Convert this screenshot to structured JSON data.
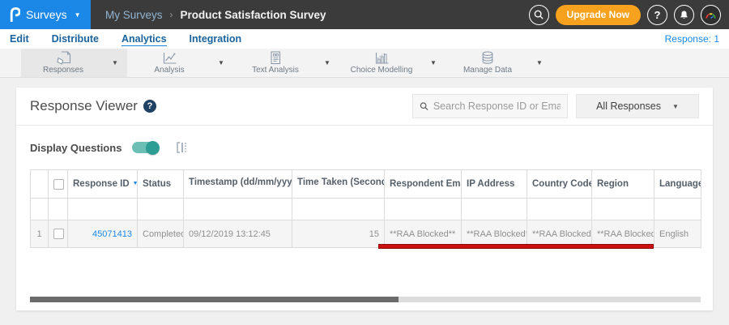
{
  "topbar": {
    "logo_letter": "P",
    "app_menu_label": "Surveys",
    "breadcrumb": {
      "parent": "My Surveys",
      "separator": "›",
      "current": "Product Satisfaction Survey"
    },
    "upgrade_button": "Upgrade Now",
    "help_badge": "?"
  },
  "nav": {
    "items": [
      {
        "label": "Edit",
        "active": false
      },
      {
        "label": "Distribute",
        "active": false
      },
      {
        "label": "Analytics",
        "active": true
      },
      {
        "label": "Integration",
        "active": false
      }
    ],
    "response_count": "Response: 1"
  },
  "toolbar": {
    "items": [
      {
        "label": "Responses",
        "icon": "responses-icon",
        "active": true
      },
      {
        "label": "Analysis",
        "icon": "line-chart-icon",
        "active": false
      },
      {
        "label": "Text Analysis",
        "icon": "text-document-icon",
        "active": false
      },
      {
        "label": "Choice Modelling",
        "icon": "bar-chart-icon",
        "active": false
      },
      {
        "label": "Manage Data",
        "icon": "database-icon",
        "active": false
      }
    ]
  },
  "viewer": {
    "title": "Response Viewer",
    "help_badge": "?",
    "search_placeholder": "Search Response ID or Email",
    "filter_selected": "All Responses",
    "display_questions_label": "Display Questions",
    "display_questions_on": true
  },
  "table": {
    "headers": {
      "response_id": "Response ID",
      "status": "Status",
      "timestamp": "Timestamp (dd/mm/yyyy)",
      "time_taken": "Time Taken (Seconds)",
      "respondent_email": "Respondent Email",
      "ip_address": "IP Address",
      "country_code": "Country Code",
      "region": "Region",
      "language": "Language"
    },
    "rows": [
      {
        "num": "1",
        "response_id": "45071413",
        "status": "Completed",
        "timestamp": "09/12/2019 13:12:45",
        "time_taken": "15",
        "respondent_email": "**RAA Blocked**",
        "ip_address": "**RAA Blocked**",
        "country_code": "**RAA Blocked**",
        "region": "**RAA Blocked**",
        "language": "English"
      }
    ]
  },
  "annotation": {
    "type": "red-underline-highlight",
    "color": "#CB1010",
    "covers": [
      "Respondent Email",
      "IP Address",
      "Country Code",
      "Region"
    ]
  },
  "scrollbar": {
    "horizontal_thumb_percent": 55
  },
  "colors": {
    "brand_blue": "#1B87E6",
    "topbar_dark": "#3B3B3B",
    "upgrade_orange": "#F6A21E",
    "toggle_teal": "#2D9E94",
    "link_blue": "#1B87E6",
    "annotation_red": "#CB1010"
  }
}
